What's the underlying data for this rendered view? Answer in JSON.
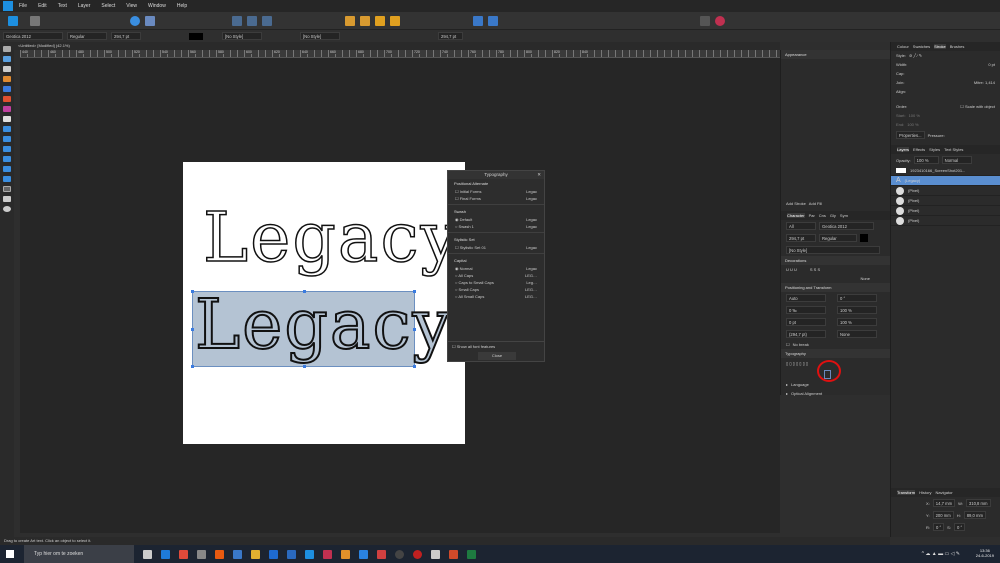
{
  "menu": [
    "File",
    "Edit",
    "Text",
    "Layer",
    "Select",
    "View",
    "Window",
    "Help"
  ],
  "context": {
    "font": "Geotica 2012",
    "weight": "Regular",
    "size": "294,7 pt",
    "char_style": "[No Style]",
    "para_style": "[No Style]",
    "size2": "294,7 pt"
  },
  "doc_tab": "<Untitled> [Modified] (42.1%)",
  "ruler_ticks": [
    "440",
    "460",
    "480",
    "500",
    "520",
    "540",
    "560",
    "580",
    "600",
    "620",
    "640",
    "660",
    "680",
    "700",
    "720",
    "740",
    "760",
    "780",
    "800",
    "820",
    "840"
  ],
  "canvas_text": "Legacy",
  "typography": {
    "title": "Typography",
    "sections": [
      {
        "name": "Positional Alternate",
        "options": [
          "Initial Forms",
          "Final Forms"
        ]
      },
      {
        "name": "Swash",
        "options": [
          "Default",
          "Swash 1"
        ]
      },
      {
        "name": "Stylistic Set",
        "options": [
          "Stylistic Set 01"
        ]
      },
      {
        "name": "Capital",
        "options": [
          "Normal",
          "All Caps",
          "Caps to Small Caps",
          "Small Caps",
          "All Small Caps"
        ]
      }
    ],
    "preview": "Legac",
    "show_all": "Show all font features",
    "close": "Close"
  },
  "appearance": {
    "title": "Appearance",
    "add_stroke": "Add Stroke",
    "add_fill": "Add Fill"
  },
  "character": {
    "tabs": [
      "Character",
      "Par",
      "Cns",
      "Gly",
      "Sym"
    ],
    "lang": "All",
    "font": "Geotica 2012",
    "size": "294,7 pt",
    "weight": "Regular",
    "style": "[No Style]",
    "decorations": "Decorations",
    "none": "None",
    "positioning": "Positioning and Transform",
    "kern": "Auto",
    "track": "0 ‰",
    "baseline": "0 pt",
    "leading": "(294,7 pt)",
    "skew": "0 °",
    "vscale": "100 %",
    "hscale": "100 %",
    "caps": "None",
    "no_break": "No break",
    "typography": "Typography",
    "language": "Language",
    "optical": "Optical Alignment"
  },
  "stroke_panel": {
    "tabs": [
      "Colour",
      "Swatches",
      "Stroke",
      "Brushes"
    ],
    "style": "Style:",
    "width": "Width:",
    "width_val": "0 pt",
    "cap": "Cap:",
    "join": "Join:",
    "align": "Align:",
    "mitre": "Mitre:",
    "mitre_val": "1,414",
    "order": "Order:",
    "scale": "Scale with object",
    "start": "Start:",
    "end": "End:",
    "pct": "100 %",
    "properties": "Properties...",
    "pressure": "Pressure:"
  },
  "layers": {
    "tabs": [
      "Layers",
      "Effects",
      "Styles",
      "Text Styles"
    ],
    "opacity": "Opacity:",
    "opacity_val": "100 %",
    "blend": "Normal",
    "items": [
      "1923410166_ScreenShot201...",
      "(Legacy)",
      "(Pixel)",
      "(Pixel)",
      "(Pixel)",
      "(Pixel)"
    ]
  },
  "transform": {
    "tabs": [
      "Transform",
      "History",
      "Navigator"
    ],
    "x": "14,7 mm",
    "y": "200 mm",
    "w": "310,8 mm",
    "h": "89,0 mm",
    "r": "0 °",
    "s": "0 °"
  },
  "status": "Drag to create Art text. Click an object to select it.",
  "taskbar": {
    "search": "Typ hier om te zoeken",
    "time": "13:36",
    "date": "24-6-2019"
  }
}
